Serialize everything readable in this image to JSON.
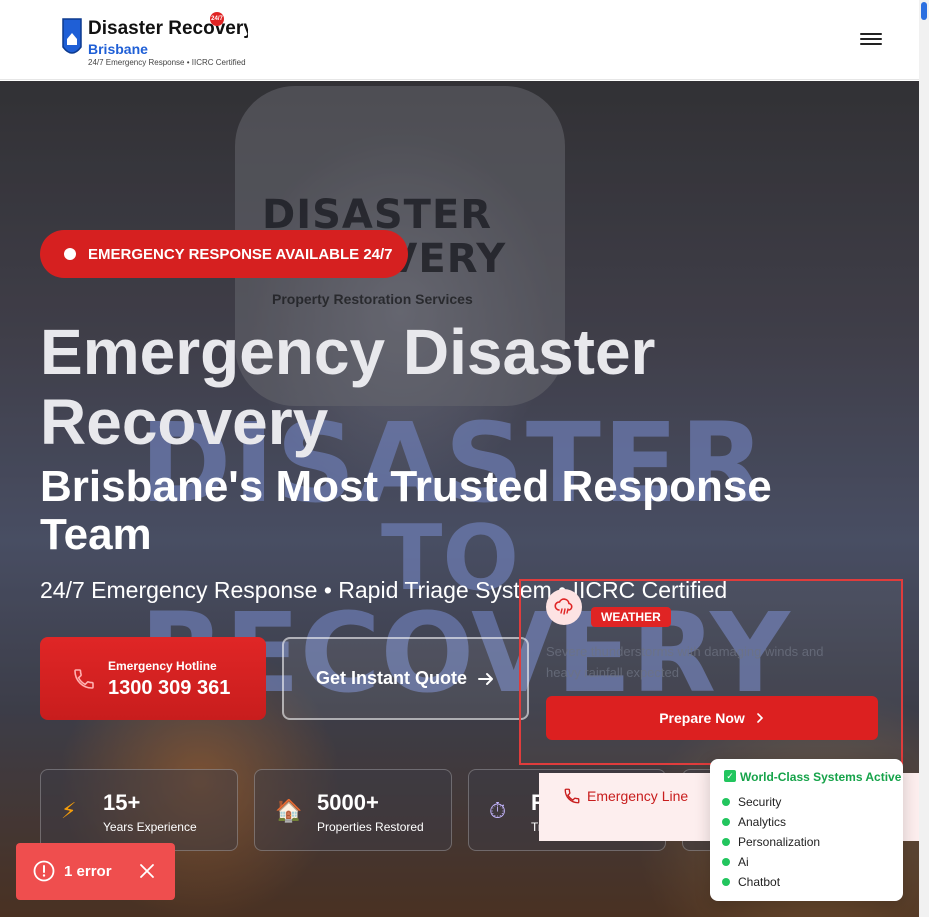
{
  "header": {
    "brand_title": "Disaster Recovery",
    "brand_location": "Brisbane",
    "brand_tagline": "24/7 Emergency Response • IICRC Certified",
    "badge": "24/7",
    "menu_icon": "hamburger-icon"
  },
  "hero": {
    "background_sign_text": "DISASTER RECOVERY",
    "background_sign_sub": "Property Restoration Services",
    "background_big_lines": [
      "DISASTER",
      "TO",
      "RECOVERY"
    ],
    "emergency_pill": "EMERGENCY RESPONSE AVAILABLE 24/7",
    "headline": "Emergency Disaster Recovery",
    "subheadline": "Brisbane's Most Trusted Response Team",
    "tagline": "24/7 Emergency Response • Rapid Triage System • IICRC Certified",
    "hotline_label": "Emergency Hotline",
    "hotline_number": "1300 309 361",
    "quote_label": "Get Instant Quote"
  },
  "stats": [
    {
      "icon": "⚡",
      "value": "15+",
      "label": "Years Experience"
    },
    {
      "icon": "🏠",
      "value": "5000+",
      "label": "Properties Restored"
    },
    {
      "icon": "⏱",
      "value": "R",
      "label": "Tr"
    }
  ],
  "weather_popup": {
    "badge": "WEATHER",
    "message": "Severe thunderstorms with damaging winds and heavy rainfall expected",
    "button": "Prepare Now"
  },
  "emergency_line": {
    "label": "Emergency Line"
  },
  "systems": {
    "title": "World-Class Systems Active",
    "items": [
      "Security",
      "Analytics",
      "Personalization",
      "Ai",
      "Chatbot"
    ]
  },
  "error_toast": {
    "text": "1 error"
  },
  "colors": {
    "accent_red": "#dc2020",
    "brand_blue": "#1f5fd6",
    "success_green": "#22c55e"
  }
}
